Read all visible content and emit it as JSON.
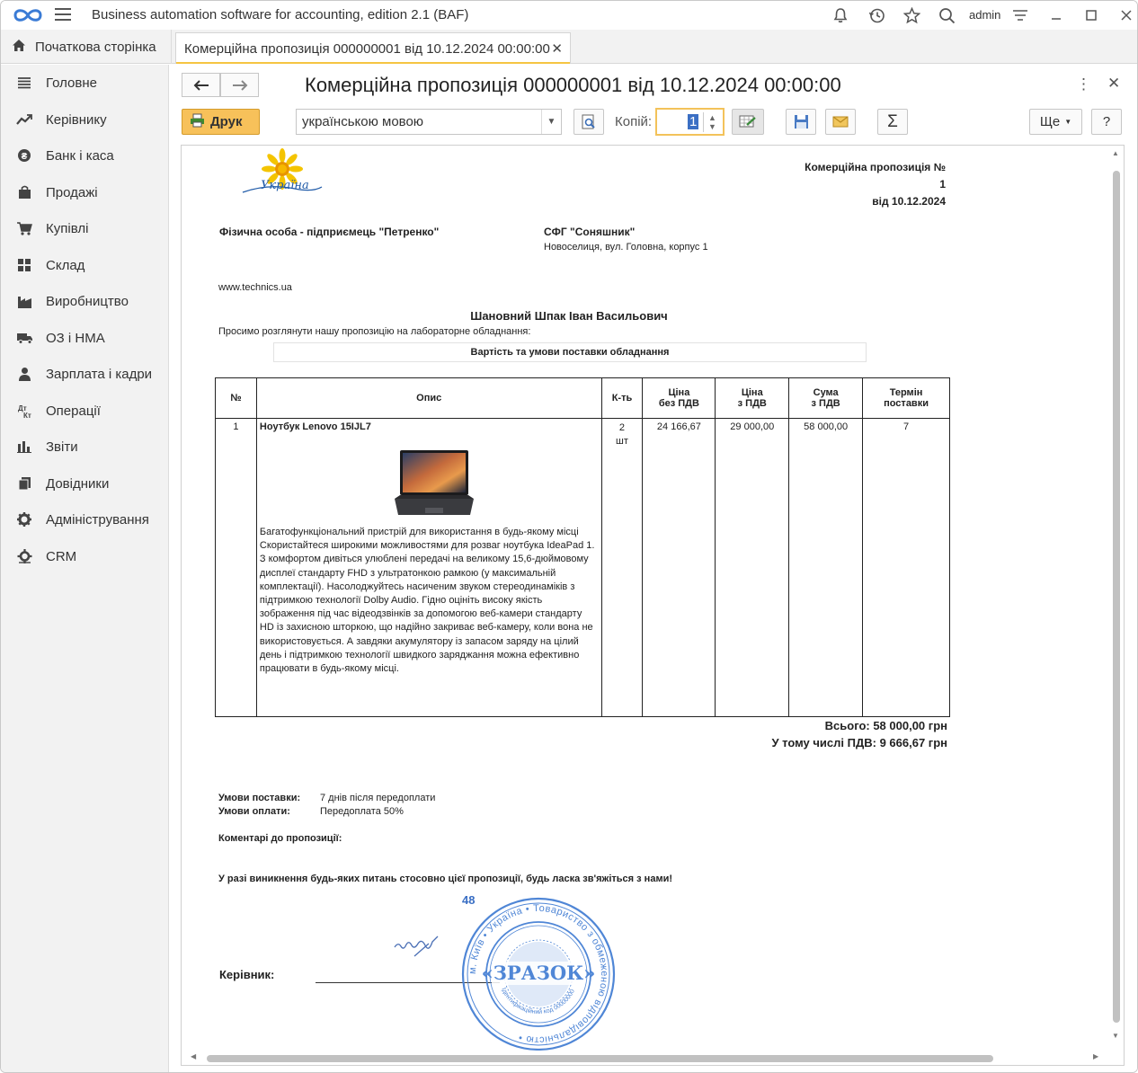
{
  "window": {
    "title": "Business automation software for accounting, edition 2.1  (BAF)",
    "user": "admin"
  },
  "tabs": {
    "home": "Початкова сторінка",
    "doc": "Комерційна пропозиція 000000001 від 10.12.2024 00:00:00"
  },
  "sidebar": {
    "items": [
      {
        "label": "Головне",
        "icon": "list-icon"
      },
      {
        "label": "Керівнику",
        "icon": "trend-icon"
      },
      {
        "label": "Банк і каса",
        "icon": "coin-icon"
      },
      {
        "label": "Продажі",
        "icon": "bag-icon"
      },
      {
        "label": "Купівлі",
        "icon": "cart-icon"
      },
      {
        "label": "Склад",
        "icon": "grid-icon"
      },
      {
        "label": "Виробництво",
        "icon": "factory-icon"
      },
      {
        "label": "ОЗ і НМА",
        "icon": "truck-icon"
      },
      {
        "label": "Зарплата і кадри",
        "icon": "person-icon"
      },
      {
        "label": "Операції",
        "icon": "ledger-icon"
      },
      {
        "label": "Звіти",
        "icon": "bar-chart-icon"
      },
      {
        "label": "Довідники",
        "icon": "books-icon"
      },
      {
        "label": "Адміністрування",
        "icon": "gear-icon"
      },
      {
        "label": "CRM",
        "icon": "crm-icon"
      }
    ]
  },
  "form": {
    "title": "Комерційна пропозиція 000000001 від 10.12.2024 00:00:00",
    "print_label": "Друк",
    "language": "українською мовою",
    "copies_label": "Копій:",
    "copies_value": "1",
    "more_label": "Ще",
    "help_label": "?",
    "sum_label": "Σ"
  },
  "doc": {
    "logo_text": "Україна",
    "header_title": "Комерційна пропозиція №",
    "header_number": "1",
    "header_date": "від 10.12.2024",
    "seller": "Фізична особа - підприємець \"Петренко\"",
    "buyer": "СФГ \"Соняшник\"",
    "buyer_address": "Новоселиця, вул. Головна, корпус 1",
    "website": "www.technics.ua",
    "greeting": "Шановний Шпак Іван Васильович",
    "intro": "Просимо розглянути нашу пропозицію на лабораторне обладнання:",
    "section_title": "Вартість та умови поставки обладнання",
    "columns": {
      "num": "№",
      "desc": "Опис",
      "qty": "К-ть",
      "price_net_1": "Ціна",
      "price_net_2": "без ПДВ",
      "price_vat_1": "Ціна",
      "price_vat_2": "з ПДВ",
      "sum_1": "Сума",
      "sum_2": "з ПДВ",
      "term_1": "Термін",
      "term_2": "поставки"
    },
    "row": {
      "num": "1",
      "name": "Ноутбук Lenovo 15IJL7",
      "description": "Багатофункціональний пристрій для використання в будь-якому місці\nСкористайтеся широкими можливостями для розваг ноутбука IdeaPad 1. З комфортом дивіться улюблені передачі на великому 15,6-дюймовому дисплеї стандарту FHD з ультратонкою рамкою (у максимальній комплектації). Насолоджуйтесь насиченим звуком стереодинаміків з підтримкою технології Dolby Audio. Гідно оцініть високу якість зображення під час відеодзвінків за допомогою веб-камери стандарту HD із захисною шторкою, що надійно закриває веб-камеру, коли вона не використовується. А завдяки акумулятору із запасом заряду на цілий день і підтримкою технології швидкого заряджання можна ефективно працювати в будь-якому місці.",
      "qty": "2",
      "unit": "шт",
      "price_net": "24 166,67",
      "price_vat": "29 000,00",
      "sum": "58 000,00",
      "term": "7"
    },
    "total": "Всього: 58 000,00 грн",
    "vat_total": "У тому числі ПДВ: 9 666,67 грн",
    "delivery_label": "Умови поставки:",
    "delivery_value": "7 днів після передоплати",
    "payment_label": "Умови оплати:",
    "payment_value": "Передоплата 50%",
    "comments_label": "Коментарі до пропозиції:",
    "contact_note": "У разі виникнення будь-яких питань стосовно цієї пропозиції, будь ласка зв'яжіться з нами!",
    "stamp_number": "48",
    "director_label": "Керівник:",
    "stamp": {
      "center": "«ЗРАЗОК»",
      "ring": "м. Київ • Україна • Товариство з обмеженою відповідальністю •",
      "inner": "Ідентифікаційний код 00000000"
    }
  }
}
